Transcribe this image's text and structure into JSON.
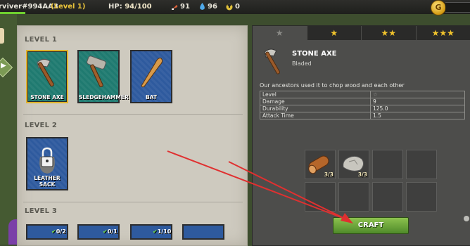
{
  "hud": {
    "player_name": "rviver#994AA3",
    "player_level": "(Level 1)",
    "hp_label": "HP:",
    "hp_value": "94/100",
    "meat": "91",
    "water": "96",
    "radiation": "0",
    "coin_symbol": "G",
    "hp_fill": 0.94
  },
  "levels": [
    {
      "heading": "LEVEL 1"
    },
    {
      "heading": "LEVEL 2"
    },
    {
      "heading": "LEVEL 3"
    }
  ],
  "cards": [
    {
      "label": "STONE AXE",
      "color": "green",
      "selected": true
    },
    {
      "label": "SLEDGEHAMMER",
      "color": "green"
    },
    {
      "label": "BAT",
      "color": "blue"
    },
    {
      "label": "LEATHER SACK",
      "color": "blue"
    }
  ],
  "level3_progress": [
    "0/2",
    "0/1",
    "1/10"
  ],
  "tabs": [
    "empty-star",
    "1-star",
    "2-stars",
    "3-stars"
  ],
  "detail": {
    "title": "STONE AXE",
    "subtitle": "Bladed",
    "description": "Our ancestors used it to chop wood and each other",
    "stats": [
      {
        "name": "Level",
        "value": ""
      },
      {
        "name": "Damage",
        "value": "9"
      },
      {
        "name": "Durability",
        "value": "125.0"
      },
      {
        "name": "Attack Time",
        "value": "1.5"
      }
    ],
    "ingredients": [
      {
        "name": "wood-log",
        "count": "3/3"
      },
      {
        "name": "stone",
        "count": "3/3"
      }
    ],
    "craft_label": "CRAFT"
  },
  "colors": {
    "accent_gold": "#e0b42c",
    "card_green": "#1f7a70",
    "card_blue": "#2e5a9e",
    "craft_green": "#6fa83c",
    "annotation_red": "#e03030"
  }
}
